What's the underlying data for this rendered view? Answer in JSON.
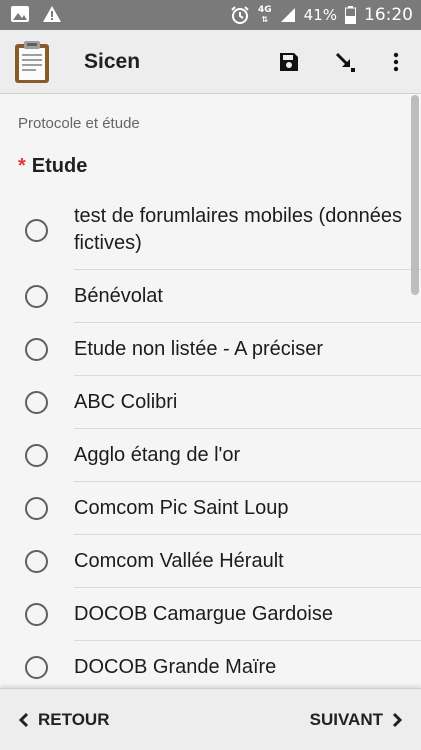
{
  "status_bar": {
    "left_icons": [
      "image-icon",
      "warning-icon"
    ],
    "network": "4G",
    "battery": "41%",
    "time": "16:20"
  },
  "app_bar": {
    "title": "Sicen",
    "actions": [
      "save-icon",
      "go-to-icon",
      "more-vert-icon"
    ]
  },
  "form": {
    "section_title": "Protocole et étude",
    "required_marker": "*",
    "question_label": "Etude",
    "options": [
      {
        "label": "test de forumlaires mobiles (données fictives)",
        "selected": false
      },
      {
        "label": "Bénévolat",
        "selected": false
      },
      {
        "label": "Etude non listée - A préciser",
        "selected": false
      },
      {
        "label": "ABC Colibri",
        "selected": false
      },
      {
        "label": "Agglo étang de l'or",
        "selected": false
      },
      {
        "label": "Comcom Pic Saint Loup",
        "selected": false
      },
      {
        "label": "Comcom Vallée Hérault",
        "selected": false
      },
      {
        "label": "DOCOB Camargue Gardoise",
        "selected": false
      },
      {
        "label": "DOCOB Grande Maïre",
        "selected": false
      }
    ]
  },
  "navigation": {
    "prev_label": "RETOUR",
    "next_label": "SUIVANT"
  }
}
